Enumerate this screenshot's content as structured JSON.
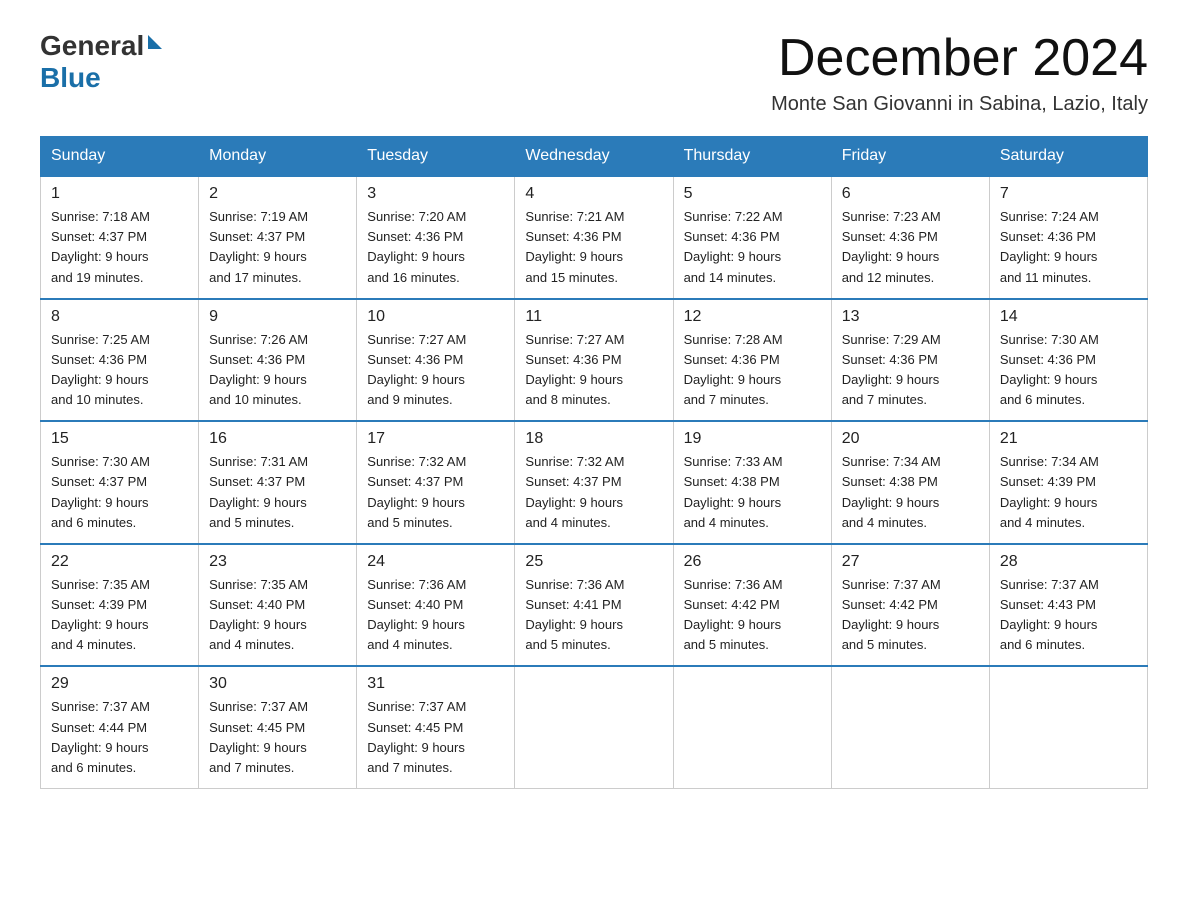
{
  "logo": {
    "general": "General",
    "blue": "Blue"
  },
  "title": {
    "month_year": "December 2024",
    "location": "Monte San Giovanni in Sabina, Lazio, Italy"
  },
  "days_of_week": [
    "Sunday",
    "Monday",
    "Tuesday",
    "Wednesday",
    "Thursday",
    "Friday",
    "Saturday"
  ],
  "weeks": [
    [
      {
        "day": "1",
        "sunrise": "7:18 AM",
        "sunset": "4:37 PM",
        "daylight": "9 hours and 19 minutes."
      },
      {
        "day": "2",
        "sunrise": "7:19 AM",
        "sunset": "4:37 PM",
        "daylight": "9 hours and 17 minutes."
      },
      {
        "day": "3",
        "sunrise": "7:20 AM",
        "sunset": "4:36 PM",
        "daylight": "9 hours and 16 minutes."
      },
      {
        "day": "4",
        "sunrise": "7:21 AM",
        "sunset": "4:36 PM",
        "daylight": "9 hours and 15 minutes."
      },
      {
        "day": "5",
        "sunrise": "7:22 AM",
        "sunset": "4:36 PM",
        "daylight": "9 hours and 14 minutes."
      },
      {
        "day": "6",
        "sunrise": "7:23 AM",
        "sunset": "4:36 PM",
        "daylight": "9 hours and 12 minutes."
      },
      {
        "day": "7",
        "sunrise": "7:24 AM",
        "sunset": "4:36 PM",
        "daylight": "9 hours and 11 minutes."
      }
    ],
    [
      {
        "day": "8",
        "sunrise": "7:25 AM",
        "sunset": "4:36 PM",
        "daylight": "9 hours and 10 minutes."
      },
      {
        "day": "9",
        "sunrise": "7:26 AM",
        "sunset": "4:36 PM",
        "daylight": "9 hours and 10 minutes."
      },
      {
        "day": "10",
        "sunrise": "7:27 AM",
        "sunset": "4:36 PM",
        "daylight": "9 hours and 9 minutes."
      },
      {
        "day": "11",
        "sunrise": "7:27 AM",
        "sunset": "4:36 PM",
        "daylight": "9 hours and 8 minutes."
      },
      {
        "day": "12",
        "sunrise": "7:28 AM",
        "sunset": "4:36 PM",
        "daylight": "9 hours and 7 minutes."
      },
      {
        "day": "13",
        "sunrise": "7:29 AM",
        "sunset": "4:36 PM",
        "daylight": "9 hours and 7 minutes."
      },
      {
        "day": "14",
        "sunrise": "7:30 AM",
        "sunset": "4:36 PM",
        "daylight": "9 hours and 6 minutes."
      }
    ],
    [
      {
        "day": "15",
        "sunrise": "7:30 AM",
        "sunset": "4:37 PM",
        "daylight": "9 hours and 6 minutes."
      },
      {
        "day": "16",
        "sunrise": "7:31 AM",
        "sunset": "4:37 PM",
        "daylight": "9 hours and 5 minutes."
      },
      {
        "day": "17",
        "sunrise": "7:32 AM",
        "sunset": "4:37 PM",
        "daylight": "9 hours and 5 minutes."
      },
      {
        "day": "18",
        "sunrise": "7:32 AM",
        "sunset": "4:37 PM",
        "daylight": "9 hours and 4 minutes."
      },
      {
        "day": "19",
        "sunrise": "7:33 AM",
        "sunset": "4:38 PM",
        "daylight": "9 hours and 4 minutes."
      },
      {
        "day": "20",
        "sunrise": "7:34 AM",
        "sunset": "4:38 PM",
        "daylight": "9 hours and 4 minutes."
      },
      {
        "day": "21",
        "sunrise": "7:34 AM",
        "sunset": "4:39 PM",
        "daylight": "9 hours and 4 minutes."
      }
    ],
    [
      {
        "day": "22",
        "sunrise": "7:35 AM",
        "sunset": "4:39 PM",
        "daylight": "9 hours and 4 minutes."
      },
      {
        "day": "23",
        "sunrise": "7:35 AM",
        "sunset": "4:40 PM",
        "daylight": "9 hours and 4 minutes."
      },
      {
        "day": "24",
        "sunrise": "7:36 AM",
        "sunset": "4:40 PM",
        "daylight": "9 hours and 4 minutes."
      },
      {
        "day": "25",
        "sunrise": "7:36 AM",
        "sunset": "4:41 PM",
        "daylight": "9 hours and 5 minutes."
      },
      {
        "day": "26",
        "sunrise": "7:36 AM",
        "sunset": "4:42 PM",
        "daylight": "9 hours and 5 minutes."
      },
      {
        "day": "27",
        "sunrise": "7:37 AM",
        "sunset": "4:42 PM",
        "daylight": "9 hours and 5 minutes."
      },
      {
        "day": "28",
        "sunrise": "7:37 AM",
        "sunset": "4:43 PM",
        "daylight": "9 hours and 6 minutes."
      }
    ],
    [
      {
        "day": "29",
        "sunrise": "7:37 AM",
        "sunset": "4:44 PM",
        "daylight": "9 hours and 6 minutes."
      },
      {
        "day": "30",
        "sunrise": "7:37 AM",
        "sunset": "4:45 PM",
        "daylight": "9 hours and 7 minutes."
      },
      {
        "day": "31",
        "sunrise": "7:37 AM",
        "sunset": "4:45 PM",
        "daylight": "9 hours and 7 minutes."
      },
      null,
      null,
      null,
      null
    ]
  ],
  "labels": {
    "sunrise": "Sunrise:",
    "sunset": "Sunset:",
    "daylight": "Daylight:"
  }
}
